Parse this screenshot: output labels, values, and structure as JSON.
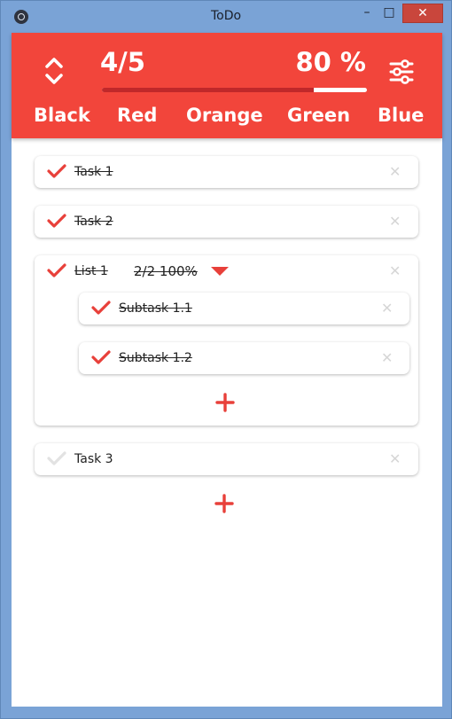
{
  "window": {
    "title": "ToDo",
    "minimize_glyph": "–",
    "maximize_glyph": "□",
    "close_glyph": "✕"
  },
  "header": {
    "count": "4/5",
    "percent": "80 %",
    "progress": 0.8,
    "accent": "#f2453b",
    "colors": [
      "Black",
      "Red",
      "Orange",
      "Green",
      "Blue"
    ]
  },
  "tasks": [
    {
      "label": "Task 1",
      "done": true
    },
    {
      "label": "Task 2",
      "done": true
    },
    {
      "label": "List 1",
      "done": true,
      "stats": "2/2 100%",
      "subtasks": [
        {
          "label": "Subtask 1.1",
          "done": true
        },
        {
          "label": "Subtask 1.2",
          "done": true
        }
      ]
    },
    {
      "label": "Task 3",
      "done": false
    }
  ],
  "icons": {
    "sort": "sort-icon",
    "settings": "settings-icon",
    "check": "check-icon",
    "delete": "close-icon",
    "add": "plus-icon",
    "expand": "caret-down-icon"
  },
  "delete_glyph": "✕"
}
